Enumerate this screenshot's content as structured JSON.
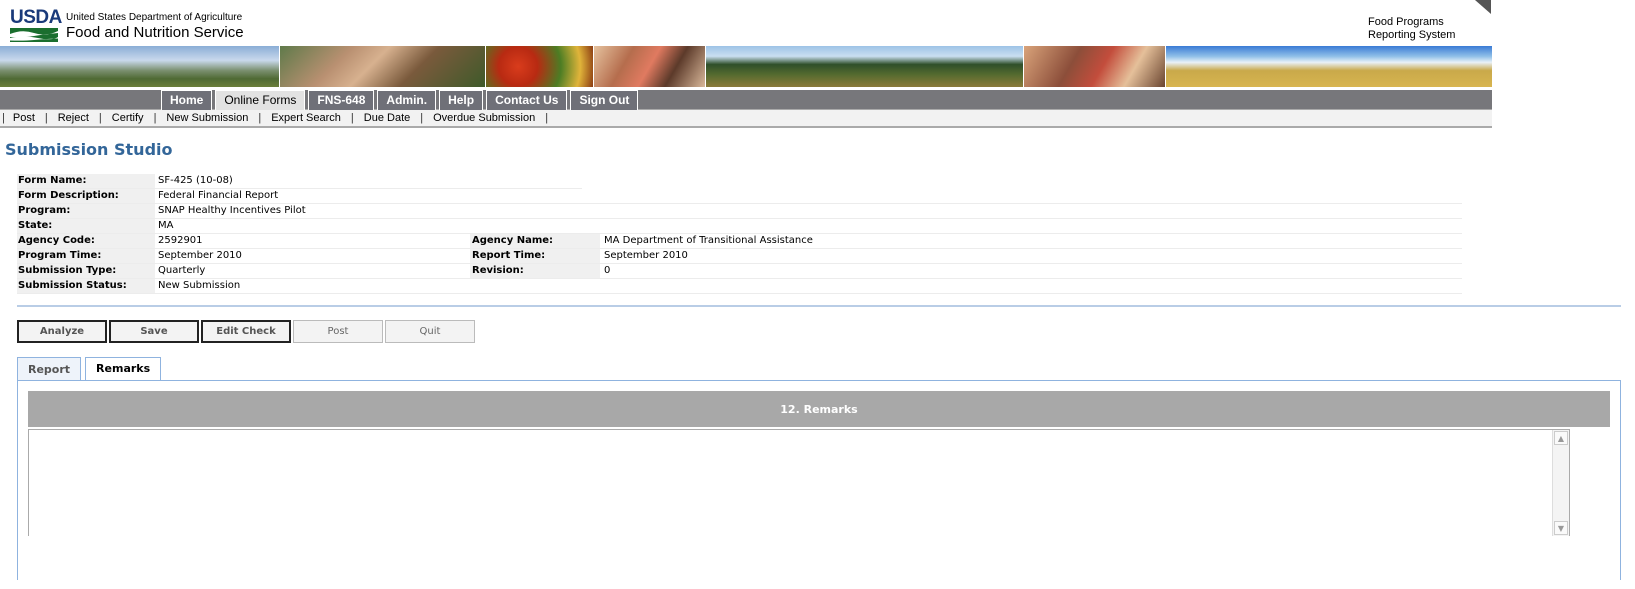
{
  "header": {
    "logo_text": "USDA",
    "department": "United States Department of Agriculture",
    "agency": "Food and Nutrition Service",
    "system_line1": "Food Programs",
    "system_line2": "Reporting System"
  },
  "nav": {
    "items": [
      {
        "label": "Home"
      },
      {
        "label": "Online Forms"
      },
      {
        "label": "FNS-648"
      },
      {
        "label": "Admin."
      },
      {
        "label": "Help"
      },
      {
        "label": "Contact Us"
      },
      {
        "label": "Sign Out"
      }
    ]
  },
  "subnav": {
    "items": [
      {
        "label": "Post"
      },
      {
        "label": "Reject"
      },
      {
        "label": "Certify"
      },
      {
        "label": "New Submission"
      },
      {
        "label": "Expert Search"
      },
      {
        "label": "Due Date"
      },
      {
        "label": "Overdue Submission"
      }
    ]
  },
  "page_title": "Submission Studio",
  "info": {
    "form_name_label": "Form Name:",
    "form_name": "SF-425 (10-08)",
    "form_description_label": "Form Description:",
    "form_description": "Federal Financial Report",
    "program_label": "Program:",
    "program": "SNAP Healthy Incentives Pilot",
    "state_label": "State:",
    "state": "MA",
    "agency_code_label": "Agency Code:",
    "agency_code": "2592901",
    "agency_name_label": "Agency Name:",
    "agency_name": "MA Department of Transitional Assistance",
    "program_time_label": "Program Time:",
    "program_time": "September 2010",
    "report_time_label": "Report Time:",
    "report_time": "September 2010",
    "submission_type_label": "Submission Type:",
    "submission_type": "Quarterly",
    "revision_label": "Revision:",
    "revision": "0",
    "submission_status_label": "Submission Status:",
    "submission_status": "New Submission"
  },
  "buttons": {
    "analyze": "Analyze",
    "save": "Save",
    "edit_check": "Edit Check",
    "post": "Post",
    "quit": "Quit"
  },
  "tabs": {
    "report": "Report",
    "remarks": "Remarks",
    "active": "Remarks"
  },
  "remarks": {
    "header": "12. Remarks",
    "value": ""
  },
  "colors": {
    "title": "#336699",
    "nav_bg": "#77777b",
    "remarks_header_bg": "#a8a8a8",
    "tab_border": "#8fb3df"
  }
}
